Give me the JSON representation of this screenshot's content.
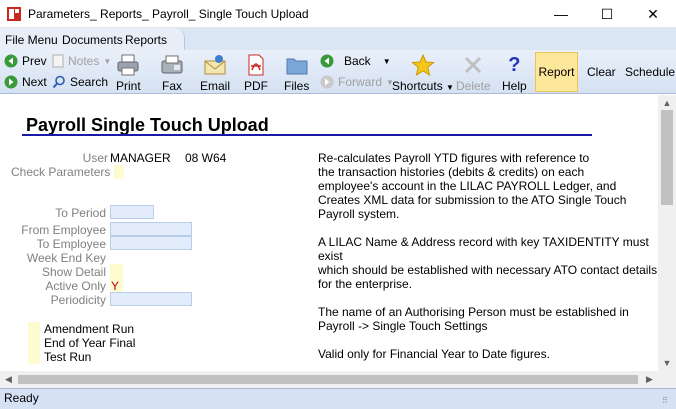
{
  "window": {
    "title": "Parameters_ Reports_ Payroll_ Single Touch Upload",
    "minimize_glyph": "—",
    "maximize_glyph": "☐",
    "close_glyph": "✕"
  },
  "menu": {
    "items": [
      "File Menu",
      "Documents",
      "Reports"
    ]
  },
  "toolbar": {
    "prev": "Prev",
    "next": "Next",
    "notes": "Notes",
    "search": "Search",
    "print": "Print",
    "fax": "Fax",
    "email": "Email",
    "pdf": "PDF",
    "files": "Files",
    "back": "Back",
    "forward": "Forward",
    "shortcuts": "Shortcuts",
    "delete": "Delete",
    "help": "Help",
    "report": "Report",
    "clear": "Clear",
    "schedule": "Schedule",
    "icons": [
      "prev-arrow-icon",
      "next-arrow-icon",
      "notes-icon",
      "search-icon",
      "printer-icon",
      "fax-icon",
      "email-icon",
      "pdf-icon",
      "folder-icon",
      "back-arrow-icon",
      "forward-arrow-icon",
      "star-icon",
      "delete-x-icon",
      "help-question-icon"
    ],
    "colors": {
      "accent_green": "#3a9a3a",
      "help_blue": "#2233bb",
      "pdf_red": "#c8281e",
      "star_yellow": "#f5c518",
      "report_highlight": "#fde79a"
    }
  },
  "form": {
    "heading": "Payroll Single Touch Upload",
    "user_label": "User",
    "user_value": "MANAGER",
    "user_extra": "08 W64",
    "check_parameters_label": "Check Parameters",
    "to_period_label": "To Period",
    "from_employee_label": "From Employee",
    "to_employee_label": "To Employee",
    "week_end_key_label": "Week End Key",
    "show_detail_label": "Show Detail",
    "active_only_label": "Active Only",
    "active_only_value": "Y",
    "periodicity_label": "Periodicity",
    "amendment_run_label": "Amendment Run",
    "end_of_year_final_label": "End of Year Final",
    "test_run_label": "Test Run",
    "field_color": "#e2ecfa",
    "checkbox_color": "#fdfbd0"
  },
  "description": {
    "para1": "Re-calculates Payroll YTD figures with reference to\nthe transaction histories (debits & credits) on each\nemployee's account in the LILAC PAYROLL Ledger, and\nCreates XML data for submission to the ATO Single Touch\nPayroll system.",
    "para2": "A LILAC Name & Address record with key TAXIDENTITY must exist\nwhich should be established with necessary ATO contact details\nfor the enterprise.",
    "para3": "The name of an Authorising Person must be established in\nPayroll -> Single Touch Settings",
    "para4": "Valid only for Financial Year to Date figures."
  },
  "status": {
    "text": "Ready"
  }
}
